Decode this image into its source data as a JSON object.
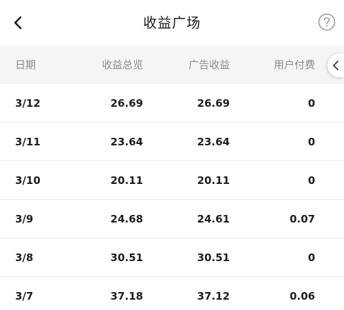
{
  "header": {
    "title": "收益广场",
    "back_icon": "chevron-left-icon",
    "help_icon": "question-circle-icon"
  },
  "table": {
    "columns": [
      "日期",
      "收益总览",
      "广告收益",
      "用户付费"
    ],
    "rows": [
      {
        "date": "3/12",
        "total": "26.69",
        "ads": "26.69",
        "paid": "0"
      },
      {
        "date": "3/11",
        "total": "23.64",
        "ads": "23.64",
        "paid": "0"
      },
      {
        "date": "3/10",
        "total": "20.11",
        "ads": "20.11",
        "paid": "0"
      },
      {
        "date": "3/9",
        "total": "24.68",
        "ads": "24.61",
        "paid": "0.07"
      },
      {
        "date": "3/8",
        "total": "30.51",
        "ads": "30.51",
        "paid": "0"
      },
      {
        "date": "3/7",
        "total": "37.18",
        "ads": "37.12",
        "paid": "0.06"
      }
    ]
  },
  "side_tab": {
    "icon": "chevron-left-icon"
  },
  "colors": {
    "header_bg": "#f5f5f5",
    "header_text": "#8a8a8a",
    "cell_text": "#1e1e1e",
    "divider": "#ececec"
  }
}
